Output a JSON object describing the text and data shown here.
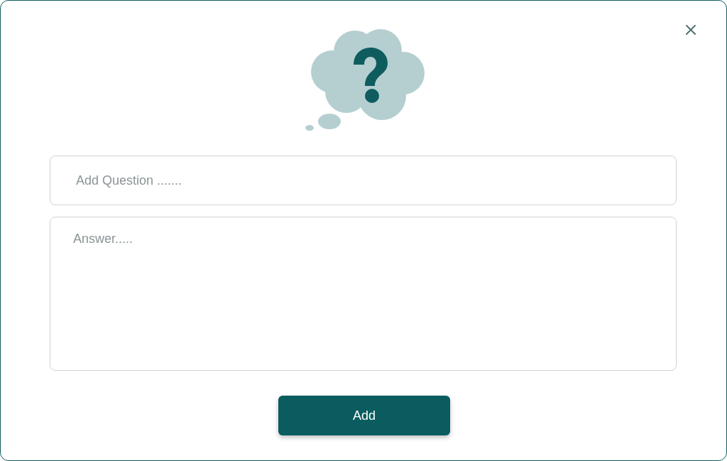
{
  "question_field": {
    "placeholder": "Add Question ......."
  },
  "answer_field": {
    "placeholder": "Answer....."
  },
  "buttons": [
    {
      "label": "Add"
    }
  ]
}
